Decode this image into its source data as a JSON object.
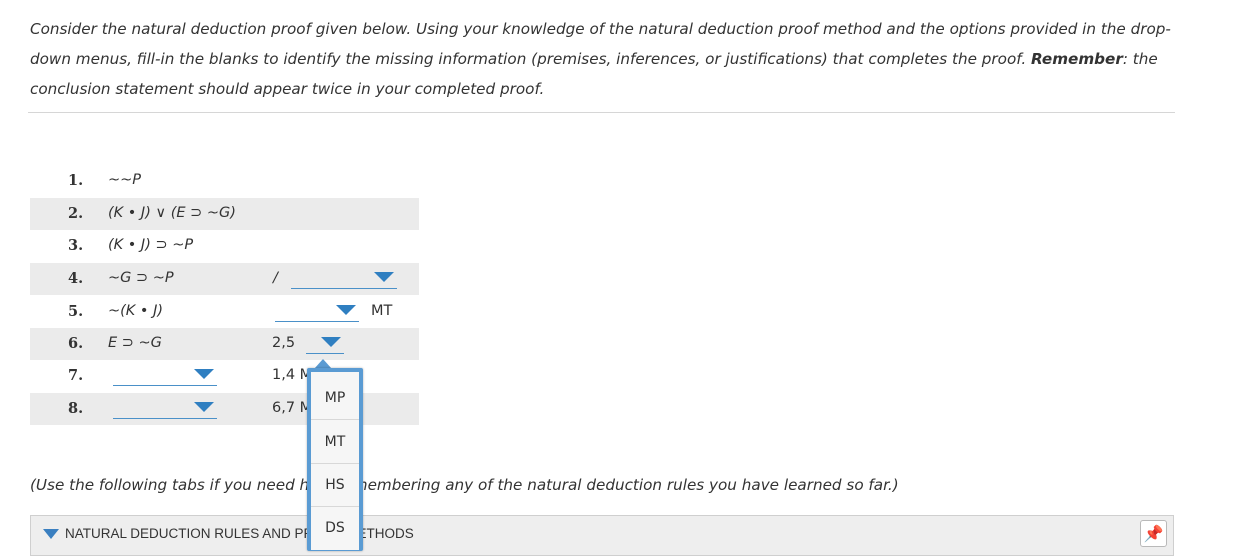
{
  "instructions": {
    "part1": "Consider the natural deduction proof given below. Using your knowledge of the natural deduction proof method and the options provided in the drop-down menus, fill-in the blanks to identify the missing information (premises, inferences, or justifications) that completes the proof. ",
    "remember": "Remember",
    "part2": ": the conclusion statement should appear twice in your completed proof."
  },
  "proof": {
    "lines": [
      {
        "num": "1.",
        "statement": "~~P"
      },
      {
        "num": "2.",
        "statement": "(K • J) ∨ (E ⊃ ~G)"
      },
      {
        "num": "3.",
        "statement": "(K • J) ⊃ ~P"
      },
      {
        "num": "4.",
        "statement": "~G ⊃ ~P",
        "slash": "/"
      },
      {
        "num": "5.",
        "statement": "~(K • J)",
        "justification_rule": "MT"
      },
      {
        "num": "6.",
        "statement": "E ⊃ ~G",
        "justification_lines": "2,5"
      },
      {
        "num": "7.",
        "statement": "",
        "justification_lines": "1,4 MT"
      },
      {
        "num": "8.",
        "statement": "",
        "justification_lines": "6,7 MT"
      }
    ]
  },
  "dropdown_menu": {
    "options": [
      "MP",
      "MT",
      "HS",
      "DS"
    ]
  },
  "note": "(Use the following tabs if you need help remembering any of the natural deduction rules you have learned so far.)",
  "accordion": {
    "title": "NATURAL DEDUCTION RULES AND PROOF METHODS",
    "pin_icon": "pin-icon"
  },
  "colors": {
    "accent": "#2f7fc1",
    "row_shade": "#ebebeb",
    "menu_border": "#5a9bd3"
  }
}
